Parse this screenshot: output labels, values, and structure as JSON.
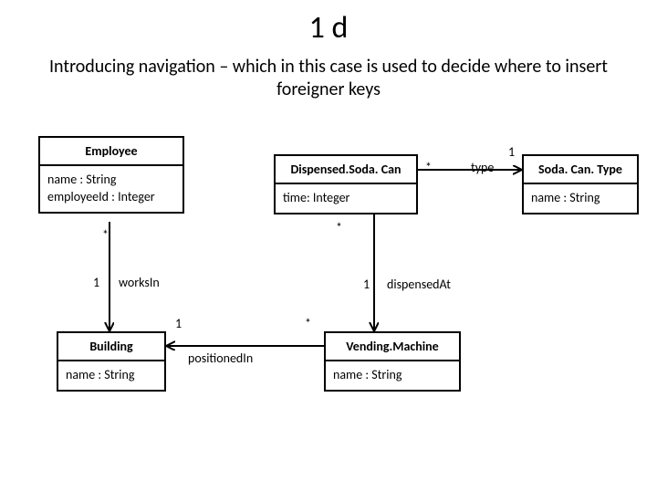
{
  "header": {
    "title": "1 d",
    "subtitle": "Introducing navigation – which in this case is used to decide where to insert foreigner keys"
  },
  "classes": {
    "employee": {
      "name": "Employee",
      "attr1": "name : String",
      "attr2": "employeeId : Integer"
    },
    "dispensedSodaCan": {
      "name": "Dispensed.Soda. Can",
      "attr1": "time: Integer"
    },
    "sodaCanType": {
      "name": "Soda. Can. Type",
      "attr1": "name : String"
    },
    "building": {
      "name": "Building",
      "attr1": "name : String"
    },
    "vendingMachine": {
      "name": "Vending.Machine",
      "attr1": "name : String"
    }
  },
  "associations": {
    "typeLabel": "type",
    "typeMultStar": "*",
    "typeMultOne": "1",
    "empStar": "*",
    "dscStar": "*",
    "worksInOne": "1",
    "worksInLabel": "worksIn",
    "dispensedAtOne": "1",
    "dispensedAtLabel": "dispensedAt",
    "positionedInOne": "1",
    "positionedInLabel": "positionedIn",
    "positionedInStar": "*"
  }
}
